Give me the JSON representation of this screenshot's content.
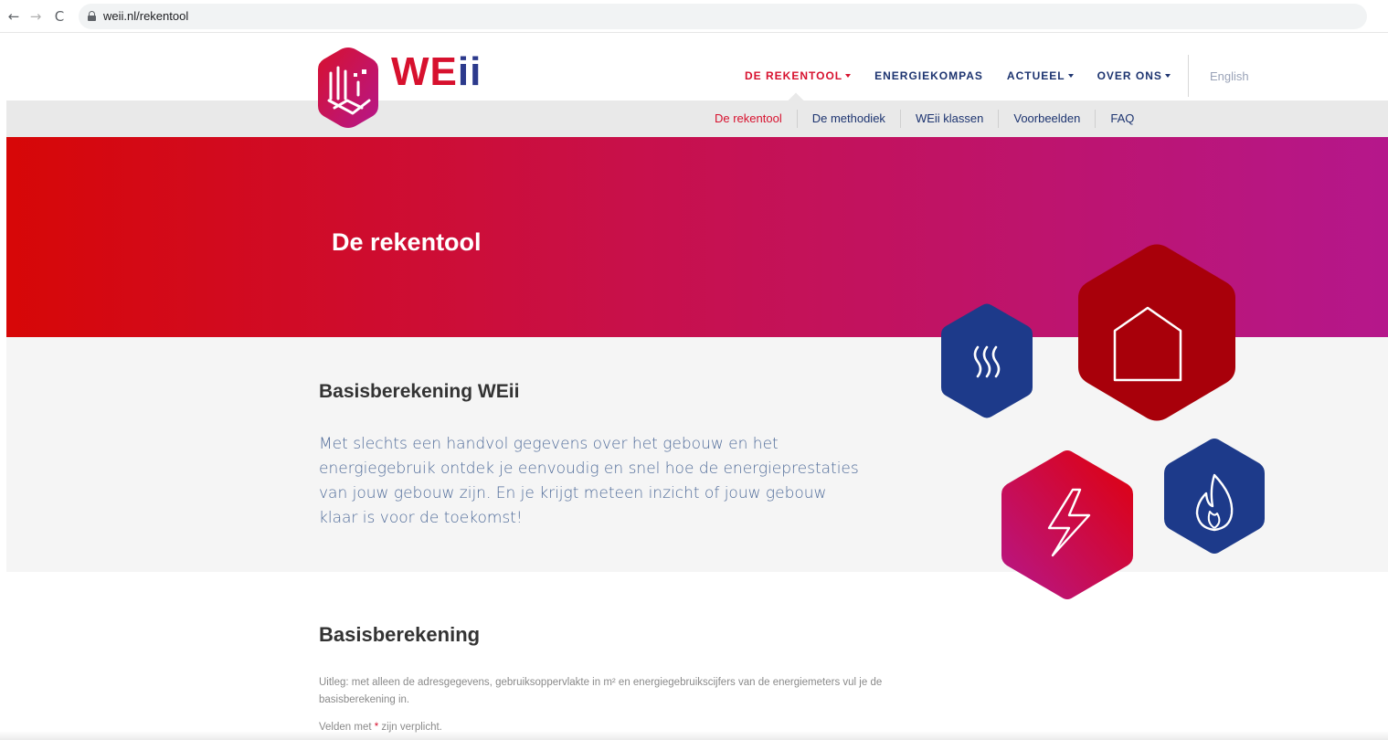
{
  "browser": {
    "url": "weii.nl/rekentool",
    "back_icon": "←",
    "forward_icon": "→",
    "reload_icon": "C"
  },
  "logo": {
    "text_w": "WE",
    "text_ii": "ii"
  },
  "main_nav": [
    {
      "label": "DE REKENTOOL",
      "has_caret": true,
      "active": true
    },
    {
      "label": "ENERGIEKOMPAS",
      "has_caret": false,
      "active": false
    },
    {
      "label": "ACTUEEL",
      "has_caret": true,
      "active": false
    },
    {
      "label": "OVER ONS",
      "has_caret": true,
      "active": false
    }
  ],
  "language_link": "English",
  "sub_nav": [
    {
      "label": "De rekentool",
      "active": true
    },
    {
      "label": "De methodiek",
      "active": false
    },
    {
      "label": "WEii klassen",
      "active": false
    },
    {
      "label": "Voorbeelden",
      "active": false
    },
    {
      "label": "FAQ",
      "active": false
    }
  ],
  "hero": {
    "title": "De rekentool"
  },
  "intro": {
    "heading": "Basisberekening WEii",
    "text": "Met slechts een handvol gegevens over het gebouw en het energiegebruik ontdek je eenvoudig en snel hoe de energieprestaties van jouw gebouw zijn. En je krijgt meteen inzicht of jouw gebouw klaar is voor de toekomst!"
  },
  "hexagons": [
    {
      "icon": "heat-icon",
      "color": "#1d3a8a"
    },
    {
      "icon": "house-icon",
      "color": "#a8000a"
    },
    {
      "icon": "lightning-icon",
      "color": "#c0127a"
    },
    {
      "icon": "flame-icon",
      "color": "#1d3a8a"
    }
  ],
  "form_intro": {
    "heading": "Basisberekening",
    "explanation": "Uitleg: met alleen de adresgegevens, gebruiksoppervlakte in m² en energiegebruikscijfers van de energiemeters vul je de basisberekening in.",
    "required_prefix": "Velden met ",
    "required_star": "*",
    "required_suffix": " zijn verplicht."
  },
  "colors": {
    "brand_red": "#d7112e",
    "brand_navy": "#1d3470",
    "hero_gradient_start": "#d70707",
    "hero_gradient_end": "#b5178b"
  }
}
